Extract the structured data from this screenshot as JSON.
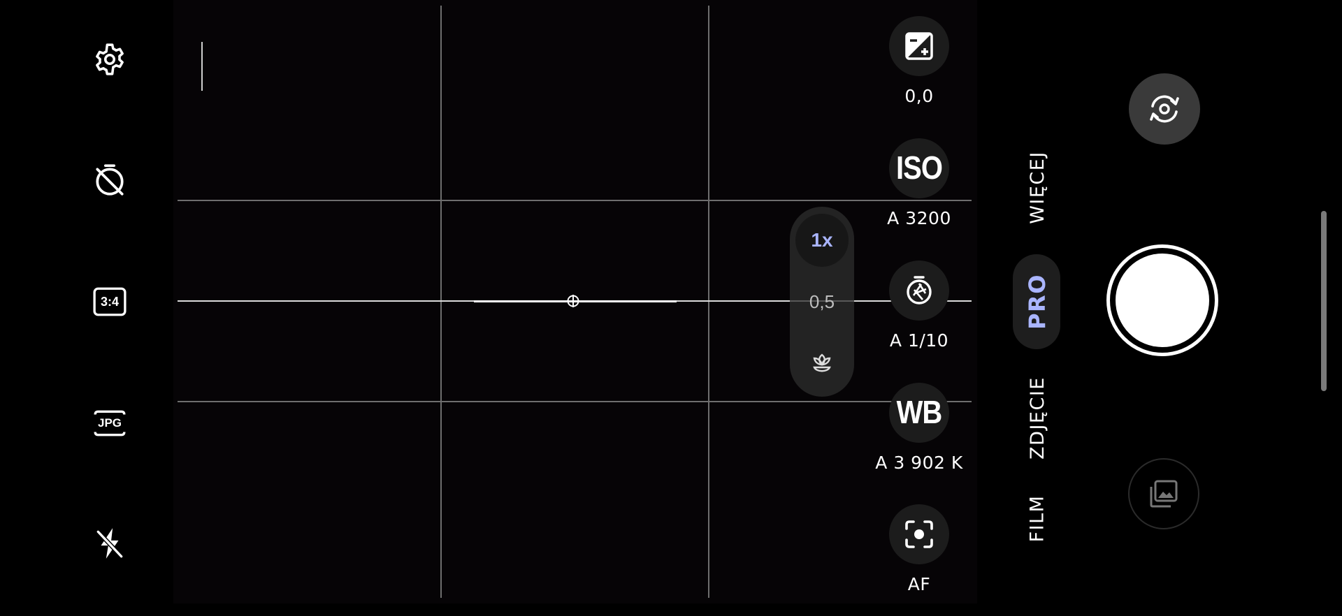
{
  "left_toolbar": {
    "settings_icon": "gear-icon",
    "timer_icon": "timer-off-icon",
    "aspect_ratio": "3:4",
    "format": "JPG",
    "flash_icon": "flash-off-icon"
  },
  "zoom": {
    "options": [
      {
        "label": "1x",
        "active": true
      },
      {
        "label": "0,5",
        "active": false
      }
    ],
    "macro_icon": "macro-flower-icon"
  },
  "pro_controls": [
    {
      "icon": "exposure-compensation-icon",
      "value": "0,0"
    },
    {
      "icon_text": "ISO",
      "value": "A 3200"
    },
    {
      "icon": "shutter-speed-icon",
      "value": "A 1/10"
    },
    {
      "icon_text": "WB",
      "value": "A 3 902 K"
    },
    {
      "icon": "autofocus-icon",
      "value": "AF"
    }
  ],
  "modes": [
    "WIĘCEJ",
    "PRO",
    "ZDJĘCIE",
    "FILM"
  ],
  "active_mode": "PRO",
  "colors": {
    "accent": "#aab5ff",
    "background": "#000000",
    "viewfinder": "#060406",
    "control_circle": "#1c1c1c"
  }
}
